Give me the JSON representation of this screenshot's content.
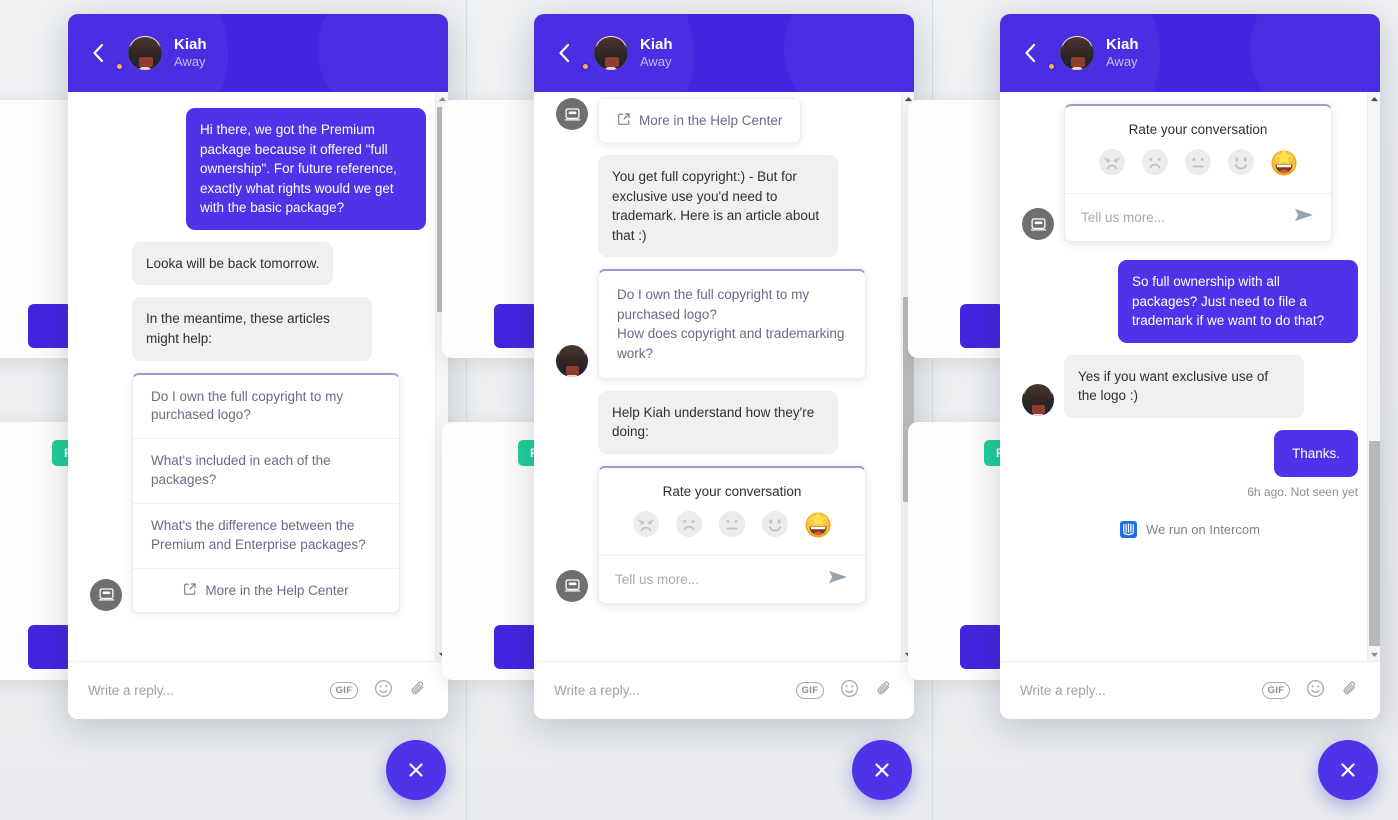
{
  "header": {
    "name": "Kiah",
    "status": "Away"
  },
  "composer": {
    "placeholder": "Write a reply...",
    "gif_label": "GIF"
  },
  "rating": {
    "title": "Rate your conversation",
    "placeholder": "Tell us more...",
    "faces": [
      "angry-face",
      "sad-face",
      "neutral-face",
      "smiling-face",
      "star-struck-face"
    ]
  },
  "colors": {
    "brand": "#4325e0",
    "bubble": "#4f33e8",
    "agent_bubble": "#f0f0f1",
    "badge_green": "#21cf9a",
    "link": "#6b6a87"
  },
  "background_cards": {
    "badge_label": "PR"
  },
  "panels": [
    {
      "id": "panel-1",
      "scroll_position": "top",
      "messages": [
        {
          "type": "user-bubble",
          "text": "Hi there, we got the Premium package because it offered \"full ownership\". For future reference, exactly what rights would we get with the basic package?"
        },
        {
          "type": "agent-bubble",
          "text": "Looka will be back tomorrow."
        },
        {
          "type": "agent-bubble",
          "text": "In the meantime, these articles might help:"
        },
        {
          "type": "article-card",
          "items": [
            "Do I own the full copyright to my purchased logo?",
            "What's included in each of the packages?",
            "What's the difference between the Premium and Enterprise packages?"
          ],
          "more_label": "More in the Help Center"
        }
      ]
    },
    {
      "id": "panel-2",
      "scroll_position": "middle",
      "messages": [
        {
          "type": "article-card-partial",
          "more_label": "More in the Help Center"
        },
        {
          "type": "agent-bubble",
          "text": "You get full copyright:) - But for exclusive use you'd need to trademark. Here is an article about that :)"
        },
        {
          "type": "quote-card",
          "lines": [
            "Do I own the full copyright to my purchased logo?",
            "How does copyright and trademarking work?"
          ]
        },
        {
          "type": "agent-bubble",
          "text": "Help Kiah understand how they're doing:"
        },
        {
          "type": "rating-widget"
        }
      ]
    },
    {
      "id": "panel-3",
      "scroll_position": "bottom",
      "messages": [
        {
          "type": "rating-widget"
        },
        {
          "type": "user-bubble",
          "text": "So full ownership with all packages? Just need to file a trademark if we want to do that?"
        },
        {
          "type": "agent-bubble",
          "text": "Yes if you want exclusive use of the logo :)"
        },
        {
          "type": "user-bubble-short",
          "text": "Thanks."
        },
        {
          "type": "timestamp",
          "text": "6h ago. Not seen yet"
        },
        {
          "type": "branding",
          "text": "We run on Intercom"
        }
      ]
    }
  ]
}
